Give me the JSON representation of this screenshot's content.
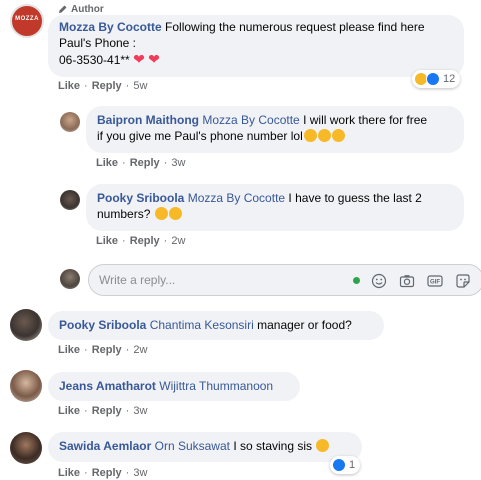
{
  "comments": [
    {
      "author": "Mozza By Cocotte",
      "badge": "Author",
      "avatar_text": "MOZZA",
      "text_lines": [
        "Following the numerous request please find here",
        "Paul's Phone :",
        "06-3530-41**"
      ],
      "reaction_count": "12",
      "like": "Like",
      "reply": "Reply",
      "time": "5w"
    },
    {
      "author": "Baipron Maithong",
      "tag": "Mozza By Cocotte",
      "text_lines": [
        "I will work there for free",
        "if you give me Paul's phone number lol"
      ],
      "like": "Like",
      "reply": "Reply",
      "time": "3w"
    },
    {
      "author": "Pooky Sriboola",
      "tag": "Mozza By Cocotte",
      "text_lines": [
        "I have to guess the last 2",
        "numbers?"
      ],
      "like": "Like",
      "reply": "Reply",
      "time": "2w"
    },
    {
      "author": "Pooky Sriboola",
      "tag": "Chantima Kesonsiri",
      "text": "manager or food?",
      "like": "Like",
      "reply": "Reply",
      "time": "2w"
    },
    {
      "author": "Jeans Amatharot",
      "tag": "Wijittra Thummanoon",
      "text": "",
      "like": "Like",
      "reply": "Reply",
      "time": "3w"
    },
    {
      "author": "Sawida Aemlaor",
      "tag": "Orn Suksawat",
      "text": "I so staving sis",
      "reaction_count": "1",
      "like": "Like",
      "reply": "Reply",
      "time": "3w"
    }
  ],
  "reply_box": {
    "placeholder": "Write a reply..."
  },
  "separator": "·",
  "colors": {
    "link": "#385898",
    "bubble": "#f0f2f5",
    "like_blue": "#1877f2",
    "heart": "#f23a5b",
    "online": "#31a24c"
  }
}
